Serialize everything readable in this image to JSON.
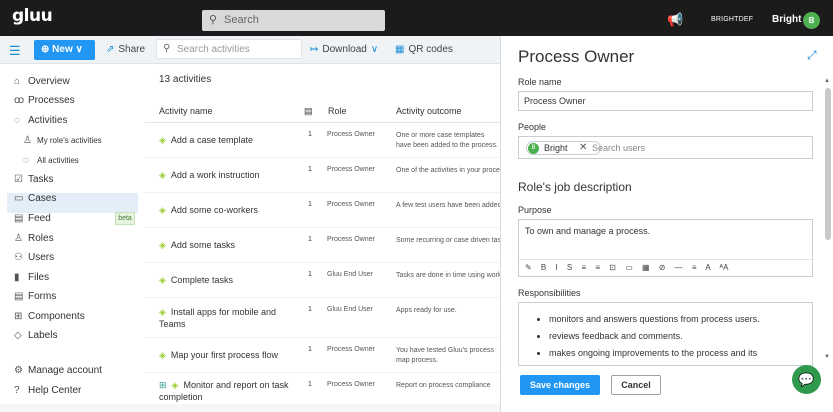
{
  "topbar": {
    "logo": "gluu",
    "search_placeholder": "Search",
    "org_name": "BRIGHTDEF",
    "user_name": "Bright",
    "avatar_initial": "B",
    "icons": [
      "search-icon",
      "megaphone-icon"
    ]
  },
  "toolbar": {
    "new_label": "New",
    "share_label": "Share",
    "search_placeholder": "Search activities",
    "download_label": "Download",
    "qr_label": "QR codes"
  },
  "sidebar": {
    "items": [
      {
        "label": "Overview",
        "icon": "home-icon",
        "glyph": "⌂"
      },
      {
        "label": "Processes",
        "icon": "processes-icon",
        "glyph": "ꝏ"
      },
      {
        "label": "Activities",
        "icon": "activities-icon",
        "glyph": "◌"
      },
      {
        "label": "My role's activities",
        "icon": "role-icon",
        "glyph": "♙"
      },
      {
        "label": "All activities",
        "icon": "activities-icon",
        "glyph": "◌"
      },
      {
        "label": "Tasks",
        "icon": "checkbox-icon",
        "glyph": "☑"
      },
      {
        "label": "Cases",
        "icon": "folder-icon",
        "glyph": "▭"
      },
      {
        "label": "Feed",
        "icon": "feed-icon",
        "glyph": "▤"
      },
      {
        "label": "Roles",
        "icon": "roles-icon",
        "glyph": "♙"
      },
      {
        "label": "Users",
        "icon": "users-icon",
        "glyph": "⚇"
      },
      {
        "label": "Files",
        "icon": "file-icon",
        "glyph": "▮"
      },
      {
        "label": "Forms",
        "icon": "form-icon",
        "glyph": "▤"
      },
      {
        "label": "Components",
        "icon": "components-icon",
        "glyph": "⊞"
      },
      {
        "label": "Labels",
        "icon": "label-icon",
        "glyph": "◇"
      },
      {
        "label": "Manage account",
        "icon": "settings-icon",
        "glyph": "⚙"
      },
      {
        "label": "Help Center",
        "icon": "help-icon",
        "glyph": "?"
      }
    ],
    "feed_badge": "beta"
  },
  "main": {
    "count": "13 activities",
    "columns": {
      "name": "Activity name",
      "role": "Role",
      "outcome": "Activity outcome"
    },
    "rows": [
      {
        "name": "Add a case template",
        "steps": "1",
        "role": "Process Owner",
        "outcome": "One or more case templates have been added to the process."
      },
      {
        "name": "Add a work instruction",
        "steps": "1",
        "role": "Process Owner",
        "outcome": "One of the activities in your process"
      },
      {
        "name": "Add some co-workers",
        "steps": "1",
        "role": "Process Owner",
        "outcome": "A few test users have been added"
      },
      {
        "name": "Add some tasks",
        "steps": "1",
        "role": "Process Owner",
        "outcome": "Some recurring or case driven tasks"
      },
      {
        "name": "Complete tasks",
        "steps": "1",
        "role": "Gluu End User",
        "outcome": "Tasks are done in time using workflow"
      },
      {
        "name": "Install apps for mobile and Teams",
        "steps": "1",
        "role": "Gluu End User",
        "outcome": "Apps ready for use."
      },
      {
        "name": "Map your first process flow",
        "steps": "1",
        "role": "Process Owner",
        "outcome": "You have tested Gluu's process map process."
      },
      {
        "name": "Monitor and report on task completion",
        "steps": "1",
        "role": "Process Owner",
        "outcome": "Report on process compliance"
      }
    ]
  },
  "panel": {
    "title": "Process Owner",
    "role_name_label": "Role name",
    "role_name_value": "Process Owner",
    "people_label": "People",
    "person_chip": "Bright",
    "person_initial": "B",
    "search_users_placeholder": "Search users",
    "job_description_title": "Role's job description",
    "purpose_label": "Purpose",
    "purpose_text": "To own and manage a process.",
    "editor_tools": "✎ B I S ≡ ≡ ⊡ ▭ ▦ ⊘ — ≡ A ᴬA",
    "responsibilities_label": "Responsibilities",
    "responsibilities": [
      "monitors and answers questions from process users.",
      "reviews feedback and comments.",
      "makes ongoing improvements to the process and its"
    ],
    "save_label": "Save changes",
    "cancel_label": "Cancel"
  }
}
